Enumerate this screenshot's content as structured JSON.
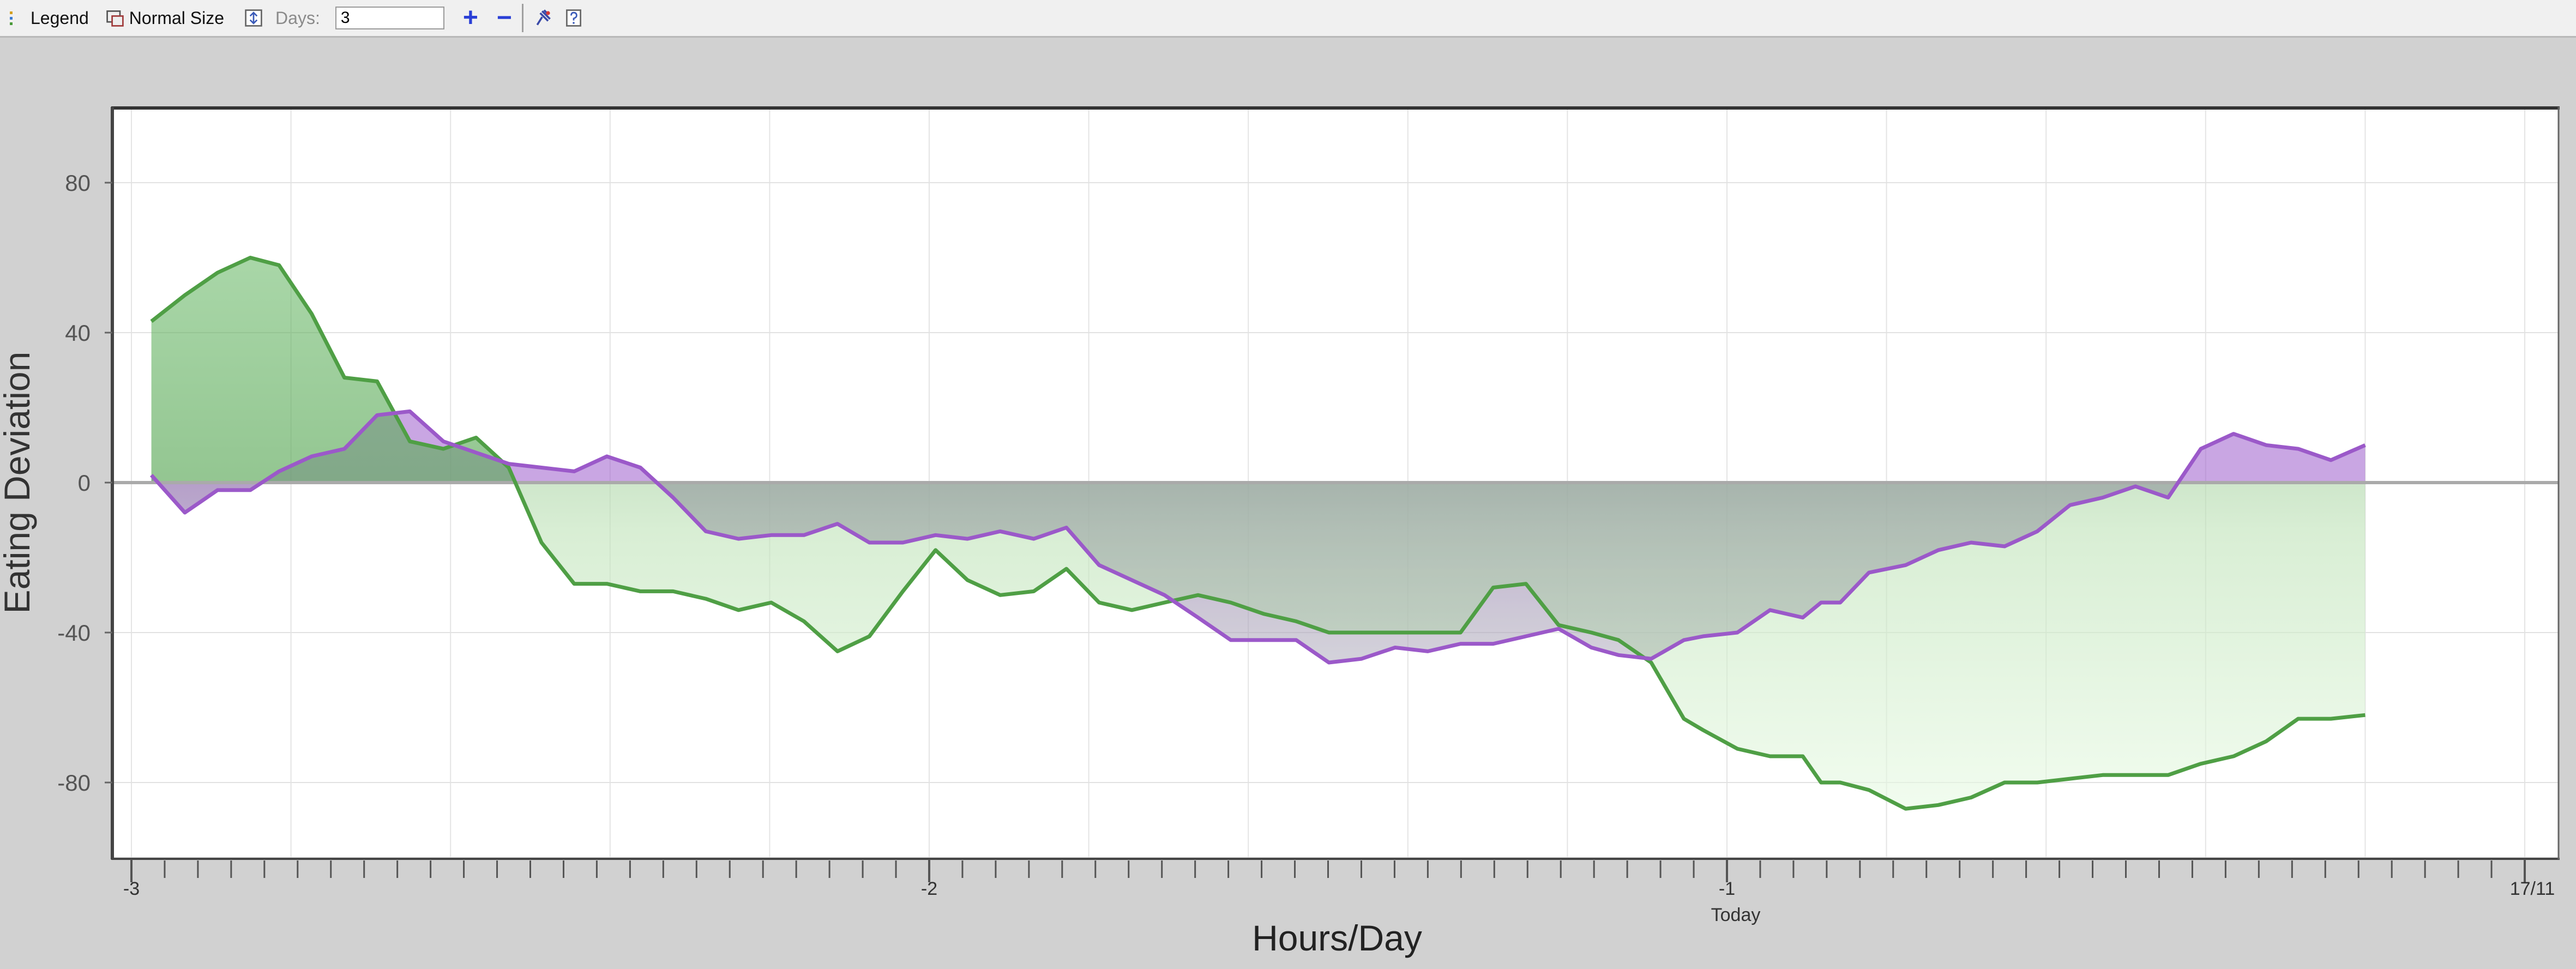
{
  "toolbar": {
    "legend_label": "Legend",
    "normal_size_label": "Normal Size",
    "days_label": "Days:",
    "days_value": "3",
    "plus_label": "+",
    "minus_label": "−"
  },
  "icons": [
    "legend-icon",
    "normal-size-icon",
    "expand-icon",
    "plus-icon",
    "minus-icon",
    "pin-icon",
    "help-icon"
  ],
  "chart_data": {
    "type": "area",
    "xlabel": "Hours/Day",
    "ylabel": "Eating Deviation",
    "xlim": [
      -3,
      0
    ],
    "ylim": [
      -100,
      100
    ],
    "yticks": [
      80,
      40,
      0,
      -40,
      -80
    ],
    "xtick_labels": [
      {
        "x": -3,
        "label": "-3"
      },
      {
        "x": -2,
        "label": "-2"
      },
      {
        "x": -1,
        "label": "-1"
      },
      {
        "x": 0,
        "label": "17/11"
      }
    ],
    "today_label": "Today",
    "grid": true,
    "colors": {
      "series_1": "#4f9f45",
      "series_2": "#9b59c9",
      "background": "#ffffff"
    },
    "series": [
      {
        "name": "",
        "color": "#4f9f45",
        "x": [
          -2.975,
          -2.933,
          -2.892,
          -2.851,
          -2.815,
          -2.774,
          -2.733,
          -2.692,
          -2.651,
          -2.609,
          -2.568,
          -2.527,
          -2.486,
          -2.445,
          -2.404,
          -2.362,
          -2.321,
          -2.28,
          -2.239,
          -2.198,
          -2.157,
          -2.115,
          -2.075,
          -2.033,
          -1.992,
          -1.952,
          -1.911,
          -1.869,
          -1.828,
          -1.787,
          -1.746,
          -1.705,
          -1.663,
          -1.622,
          -1.581,
          -1.54,
          -1.499,
          -1.458,
          -1.416,
          -1.375,
          -1.334,
          -1.293,
          -1.252,
          -1.211,
          -1.17,
          -1.136,
          -1.095,
          -1.054,
          -1.03,
          -0.987,
          -0.946,
          -0.905,
          -0.882,
          -0.858,
          -0.822,
          -0.776,
          -0.735,
          -0.694,
          -0.652,
          -0.611,
          -0.57,
          -0.529,
          -0.488,
          -0.447,
          -0.406,
          -0.365,
          -0.324,
          -0.284,
          -0.243,
          -0.2
        ],
        "values": [
          43,
          50,
          56,
          60,
          58,
          45,
          28,
          27,
          11,
          9,
          12,
          4,
          -16,
          -27,
          -27,
          -29,
          -29,
          -31,
          -34,
          -32,
          -37,
          -45,
          -41,
          -29,
          -18,
          -26,
          -30,
          -29,
          -23,
          -32,
          -34,
          -32,
          -30,
          -32,
          -35,
          -37,
          -40,
          -40,
          -40,
          -40,
          -40,
          -28,
          -27,
          -38,
          -40,
          -42,
          -48,
          -63,
          -66,
          -71,
          -73,
          -73,
          -80,
          -80,
          -82,
          -87,
          -86,
          -84,
          -80,
          -80,
          -79,
          -78,
          -78,
          -78,
          -75,
          -73,
          -69,
          -63,
          -63,
          -62
        ]
      },
      {
        "name": "",
        "color": "#9b59c9",
        "x": [
          -2.975,
          -2.933,
          -2.892,
          -2.851,
          -2.815,
          -2.774,
          -2.733,
          -2.692,
          -2.651,
          -2.609,
          -2.568,
          -2.527,
          -2.486,
          -2.445,
          -2.404,
          -2.362,
          -2.321,
          -2.28,
          -2.239,
          -2.198,
          -2.157,
          -2.115,
          -2.075,
          -2.033,
          -1.992,
          -1.952,
          -1.911,
          -1.869,
          -1.828,
          -1.787,
          -1.746,
          -1.705,
          -1.663,
          -1.622,
          -1.581,
          -1.54,
          -1.499,
          -1.458,
          -1.416,
          -1.375,
          -1.334,
          -1.293,
          -1.252,
          -1.211,
          -1.17,
          -1.136,
          -1.095,
          -1.054,
          -1.03,
          -0.987,
          -0.946,
          -0.905,
          -0.882,
          -0.858,
          -0.822,
          -0.776,
          -0.735,
          -0.694,
          -0.652,
          -0.611,
          -0.57,
          -0.529,
          -0.488,
          -0.447,
          -0.406,
          -0.365,
          -0.324,
          -0.284,
          -0.243,
          -0.2
        ],
        "values": [
          2,
          -8,
          -2,
          -2,
          3,
          7,
          9,
          18,
          19,
          11,
          8,
          5,
          4,
          3,
          7,
          4,
          -4,
          -13,
          -15,
          -14,
          -14,
          -11,
          -16,
          -16,
          -14,
          -15,
          -13,
          -15,
          -12,
          -22,
          -26,
          -30,
          -36,
          -42,
          -42,
          -42,
          -48,
          -47,
          -44,
          -45,
          -43,
          -43,
          -41,
          -39,
          -44,
          -46,
          -47,
          -42,
          -41,
          -40,
          -34,
          -36,
          -32,
          -32,
          -24,
          -22,
          -18,
          -16,
          -17,
          -13,
          -6,
          -4,
          -1,
          -4,
          9,
          13,
          10,
          9,
          6,
          10
        ]
      }
    ]
  }
}
